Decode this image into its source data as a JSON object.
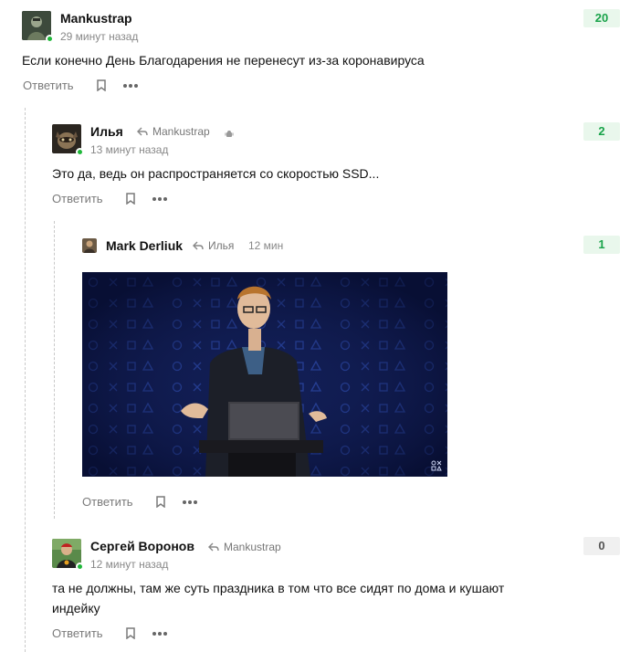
{
  "comments": [
    {
      "author": "Mankustrap",
      "time": "29 минут назад",
      "text": "Если конечно День Благодарения не перенесут из-за коронавируса",
      "score": "20",
      "reply_label": "Ответить"
    },
    {
      "author": "Илья",
      "reply_to": "Mankustrap",
      "time": "13 минут назад",
      "text": "Это да, ведь он распространяется со скоростью SSD...",
      "score": "2",
      "reply_label": "Ответить"
    },
    {
      "author": "Mark Derliuk",
      "reply_to": "Илья",
      "time": "12 мин",
      "score": "1",
      "reply_label": "Ответить"
    },
    {
      "author": "Сергей Воронов",
      "reply_to": "Mankustrap",
      "time": "12 минут назад",
      "text_line1": "та не должны, там же суть праздника в том что все сидят по дома и кушают",
      "text_line2": "индейку",
      "score": "0",
      "reply_label": "Ответить"
    }
  ],
  "icons": {
    "reply_arrow": "reply-arrow-icon",
    "bookmark": "bookmark-icon",
    "more": "more-dots-icon",
    "device": "android-icon"
  },
  "colors": {
    "score_positive_bg": "#e9f7ec",
    "score_positive_text": "#19a34a",
    "score_zero_bg": "#f0f0f0",
    "online": "#1fb83a",
    "video_bg": "#101a4c"
  }
}
